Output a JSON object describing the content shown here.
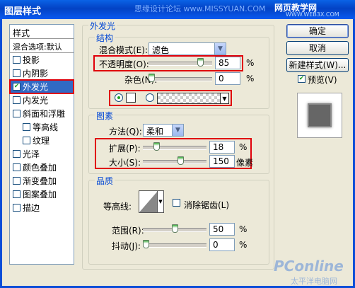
{
  "window": {
    "title": "图层样式",
    "watermark_center": "思缘设计论坛 www.MISSYUAN.COM",
    "watermark_right_main": "网页教学网",
    "watermark_right_sub": "WWW.WEB3X.COM",
    "watermark_bottom": "PConline",
    "watermark_bottom_sub": "太平洋电脑网"
  },
  "stylelist": {
    "header": "样式",
    "blend_default": "混合选项:默认",
    "items": [
      {
        "label": "投影",
        "checked": false,
        "indent": false
      },
      {
        "label": "内阴影",
        "checked": false,
        "indent": false
      },
      {
        "label": "外发光",
        "checked": true,
        "indent": false,
        "active": true
      },
      {
        "label": "内发光",
        "checked": false,
        "indent": false
      },
      {
        "label": "斜面和浮雕",
        "checked": false,
        "indent": false
      },
      {
        "label": "等高线",
        "checked": false,
        "indent": true
      },
      {
        "label": "纹理",
        "checked": false,
        "indent": true
      },
      {
        "label": "光泽",
        "checked": false,
        "indent": false
      },
      {
        "label": "颜色叠加",
        "checked": false,
        "indent": false
      },
      {
        "label": "渐变叠加",
        "checked": false,
        "indent": false
      },
      {
        "label": "图案叠加",
        "checked": false,
        "indent": false
      },
      {
        "label": "描边",
        "checked": false,
        "indent": false
      }
    ]
  },
  "outer_glow": {
    "title": "外发光",
    "structure": {
      "title": "结构",
      "blend_mode_label": "混合模式(E):",
      "blend_mode_value": "滤色",
      "opacity_label": "不透明度(O):",
      "opacity_value": "85",
      "opacity_unit": "%",
      "opacity_level": 0.85,
      "noise_label": "杂色(N):",
      "noise_value": "0",
      "noise_unit": "%",
      "noise_level": 0
    },
    "elements": {
      "title": "图素",
      "method_label": "方法(Q):",
      "method_value": "柔和",
      "spread_label": "扩展(P):",
      "spread_value": "18",
      "spread_unit": "%",
      "spread_level": 0.18,
      "size_label": "大小(S):",
      "size_value": "150",
      "size_unit": "像素",
      "size_level": 0.6
    },
    "quality": {
      "title": "品质",
      "contour_label": "等高线:",
      "antialias_label": "消除锯齿(L)",
      "range_label": "范围(R):",
      "range_value": "50",
      "range_unit": "%",
      "range_level": 0.5,
      "jitter_label": "抖动(J):",
      "jitter_value": "0",
      "jitter_unit": "%",
      "jitter_level": 0
    }
  },
  "buttons": {
    "ok": "确定",
    "cancel": "取消",
    "new_style": "新建样式(W)...",
    "preview_label": "预览(V)"
  },
  "colors": {
    "accent": "#0046d5",
    "highlight_red": "#e0000a",
    "selected": "#316ac5"
  }
}
